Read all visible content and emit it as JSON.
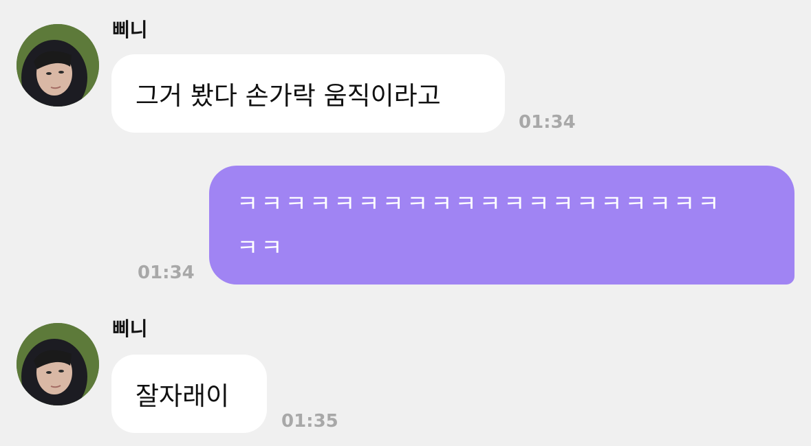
{
  "conversation": {
    "messages": [
      {
        "direction": "incoming",
        "sender": "삐니",
        "text": "그거 봤다 손가락 움직이라고",
        "time": "01:34"
      },
      {
        "direction": "outgoing",
        "text_line1": "ㅋㅋㅋㅋㅋㅋㅋㅋㅋㅋㅋㅋㅋㅋㅋㅋㅋㅋㅋㅋ",
        "text_line2": "ㅋㅋ",
        "time": "01:34"
      },
      {
        "direction": "incoming",
        "sender": "삐니",
        "text": "잘자래이",
        "time": "01:35"
      }
    ]
  },
  "colors": {
    "background": "#f0f0f0",
    "incoming_bubble": "#ffffff",
    "outgoing_bubble": "#a084f3",
    "timestamp": "#a8a8a8"
  },
  "icons": {
    "avatar": "profile-photo-avatar"
  }
}
